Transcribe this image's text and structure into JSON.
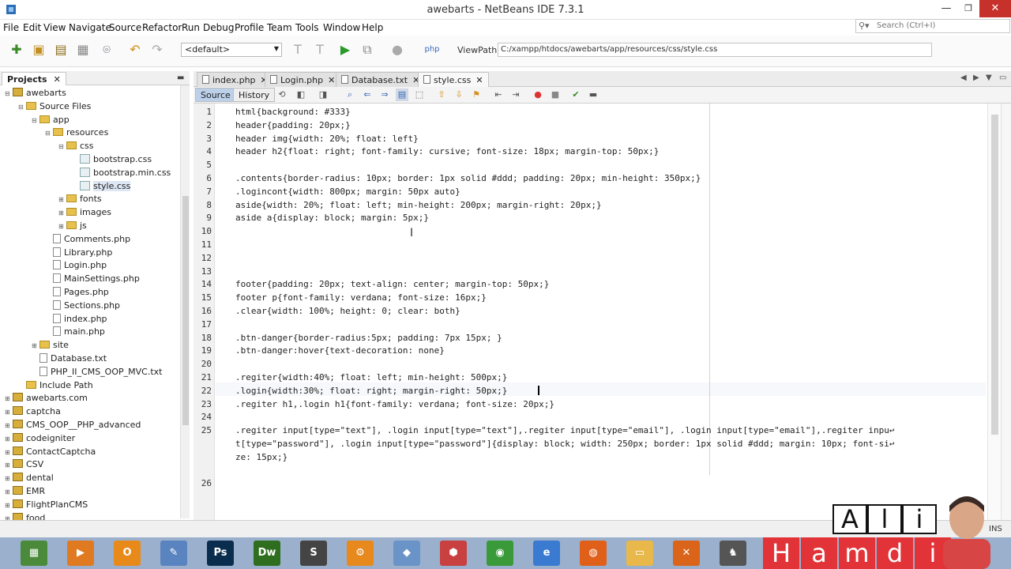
{
  "window": {
    "title": "awebarts - NetBeans IDE 7.3.1",
    "min": "—",
    "max": "❐",
    "close": "✕"
  },
  "menu": [
    "File",
    "Edit",
    "View",
    "Navigate",
    "Source",
    "Refactor",
    "Run",
    "Debug",
    "Profile",
    "Team",
    "Tools",
    "Window",
    "Help"
  ],
  "search": {
    "placeholder": "Search (Ctrl+I)"
  },
  "toolbar": {
    "config": "<default>",
    "viewpath_label": "ViewPath :",
    "viewpath_value": "C:/xampp/htdocs/awebarts/app/resources/css/style.css"
  },
  "projects": {
    "tab": "Projects",
    "tree": [
      {
        "label": "awebarts",
        "kind": "proj",
        "level": 0,
        "exp": "⊟"
      },
      {
        "label": "Source Files",
        "kind": "fold",
        "level": 1,
        "exp": "⊟"
      },
      {
        "label": "app",
        "kind": "fold",
        "level": 2,
        "exp": "⊟"
      },
      {
        "label": "resources",
        "kind": "fold",
        "level": 3,
        "exp": "⊟"
      },
      {
        "label": "css",
        "kind": "fold",
        "level": 4,
        "exp": "⊟"
      },
      {
        "label": "bootstrap.css",
        "kind": "css",
        "level": 5,
        "exp": ""
      },
      {
        "label": "bootstrap.min.css",
        "kind": "css",
        "level": 5,
        "exp": ""
      },
      {
        "label": "style.css",
        "kind": "css",
        "level": 5,
        "exp": "",
        "selected": true
      },
      {
        "label": "fonts",
        "kind": "fold",
        "level": 4,
        "exp": "⊞"
      },
      {
        "label": "images",
        "kind": "fold",
        "level": 4,
        "exp": "⊞"
      },
      {
        "label": "js",
        "kind": "fold",
        "level": 4,
        "exp": "⊞"
      },
      {
        "label": "Comments.php",
        "kind": "file",
        "level": 3,
        "exp": ""
      },
      {
        "label": "Library.php",
        "kind": "file",
        "level": 3,
        "exp": ""
      },
      {
        "label": "Login.php",
        "kind": "file",
        "level": 3,
        "exp": ""
      },
      {
        "label": "MainSettings.php",
        "kind": "file",
        "level": 3,
        "exp": ""
      },
      {
        "label": "Pages.php",
        "kind": "file",
        "level": 3,
        "exp": ""
      },
      {
        "label": "Sections.php",
        "kind": "file",
        "level": 3,
        "exp": ""
      },
      {
        "label": "index.php",
        "kind": "file",
        "level": 3,
        "exp": ""
      },
      {
        "label": "main.php",
        "kind": "file",
        "level": 3,
        "exp": ""
      },
      {
        "label": "site",
        "kind": "fold",
        "level": 2,
        "exp": "⊞"
      },
      {
        "label": "Database.txt",
        "kind": "file",
        "level": 2,
        "exp": ""
      },
      {
        "label": "PHP_II_CMS_OOP_MVC.txt",
        "kind": "file",
        "level": 2,
        "exp": ""
      },
      {
        "label": "Include Path",
        "kind": "fold",
        "level": 1,
        "exp": ""
      },
      {
        "label": "awebarts.com",
        "kind": "proj",
        "level": 0,
        "exp": "⊞"
      },
      {
        "label": "captcha",
        "kind": "proj",
        "level": 0,
        "exp": "⊞"
      },
      {
        "label": "CMS_OOP__PHP_advanced",
        "kind": "proj",
        "level": 0,
        "exp": "⊞"
      },
      {
        "label": "codeigniter",
        "kind": "proj",
        "level": 0,
        "exp": "⊞"
      },
      {
        "label": "ContactCaptcha",
        "kind": "proj",
        "level": 0,
        "exp": "⊞"
      },
      {
        "label": "CSV",
        "kind": "proj",
        "level": 0,
        "exp": "⊞"
      },
      {
        "label": "dental",
        "kind": "proj",
        "level": 0,
        "exp": "⊞"
      },
      {
        "label": "EMR",
        "kind": "proj",
        "level": 0,
        "exp": "⊞"
      },
      {
        "label": "FlightPlanCMS",
        "kind": "proj",
        "level": 0,
        "exp": "⊞"
      },
      {
        "label": "food",
        "kind": "proj",
        "level": 0,
        "exp": "⊞"
      }
    ]
  },
  "editor": {
    "tabs": [
      "index.php",
      "Login.php",
      "Database.txt",
      "style.css"
    ],
    "active_tab": 3,
    "source_label": "Source",
    "history_label": "History",
    "lines": [
      {
        "n": "1",
        "text": "html{background: #333}"
      },
      {
        "n": "2",
        "text": "header{padding: 20px;}"
      },
      {
        "n": "3",
        "text": "header img{width: 20%; float: left}"
      },
      {
        "n": "4",
        "text": "header h2{float: right; font-family: cursive; font-size: 18px; margin-top: 50px;}"
      },
      {
        "n": "5",
        "text": ""
      },
      {
        "n": "6",
        "text": ".contents{border-radius: 10px; border: 1px solid #ddd; padding: 20px; min-height: 350px;}"
      },
      {
        "n": "7",
        "text": ".logincont{width: 800px; margin: 50px auto}"
      },
      {
        "n": "8",
        "text": "aside{width: 20%; float: left; min-height: 200px; margin-right: 20px;}"
      },
      {
        "n": "9",
        "text": "aside a{display: block; margin: 5px;}"
      },
      {
        "n": "10",
        "text": ""
      },
      {
        "n": "11",
        "text": ""
      },
      {
        "n": "12",
        "text": ""
      },
      {
        "n": "13",
        "text": ""
      },
      {
        "n": "14",
        "text": "footer{padding: 20px; text-align: center; margin-top: 50px;}"
      },
      {
        "n": "15",
        "text": "footer p{font-family: verdana; font-size: 16px;}"
      },
      {
        "n": "16",
        "text": ".clear{width: 100%; height: 0; clear: both}"
      },
      {
        "n": "17",
        "text": ""
      },
      {
        "n": "18",
        "text": ".btn-danger{border-radius:5px; padding: 7px 15px; }"
      },
      {
        "n": "19",
        "text": ".btn-danger:hover{text-decoration: none}"
      },
      {
        "n": "20",
        "text": ""
      },
      {
        "n": "21",
        "text": ".regiter{width:40%; float: left; min-height: 500px;}"
      },
      {
        "n": "22",
        "text": ".login{width:30%; float: right; margin-right: 50px;}"
      },
      {
        "n": "23",
        "text": ".regiter h1,.login h1{font-family: verdana; font-size: 20px;}"
      },
      {
        "n": "24",
        "text": ""
      },
      {
        "n": "25",
        "text": ".regiter input[type=\"text\"], .login input[type=\"text\"],.regiter input[type=\"email\"], .login input[type=\"email\"],.regiter inpu↩"
      },
      {
        "n": "",
        "text": "t[type=\"password\"], .login input[type=\"password\"]{display: block; width: 250px; border: 1px solid #ddd; margin: 10px; font-si↩"
      },
      {
        "n": "",
        "text": "ze: 15px;}"
      },
      {
        "n": "",
        "text": ""
      },
      {
        "n": "26",
        "text": ""
      }
    ]
  },
  "status": {
    "mode": "INS"
  },
  "taskbar": [
    {
      "name": "chart-app-icon",
      "glyph": "▦",
      "color": "#4a8a3a"
    },
    {
      "name": "media-player-icon",
      "glyph": "▶",
      "color": "#e07a20"
    },
    {
      "name": "outlook-icon",
      "glyph": "O",
      "color": "#e88a1a"
    },
    {
      "name": "notepad-icon",
      "glyph": "✎",
      "color": "#5a84c0"
    },
    {
      "name": "photoshop-icon",
      "glyph": "Ps",
      "color": "#0b2d4d"
    },
    {
      "name": "dreamweaver-icon",
      "glyph": "Dw",
      "color": "#2e6e1e"
    },
    {
      "name": "sublime-icon",
      "glyph": "S",
      "color": "#444444"
    },
    {
      "name": "settings-icon",
      "glyph": "⚙",
      "color": "#e8891e"
    },
    {
      "name": "netbeans-icon",
      "glyph": "◆",
      "color": "#6a94c8"
    },
    {
      "name": "shield-app-icon",
      "glyph": "⬢",
      "color": "#c84040"
    },
    {
      "name": "chrome-icon",
      "glyph": "◉",
      "color": "#3a9a3a"
    },
    {
      "name": "ie-icon",
      "glyph": "e",
      "color": "#3a7ad0"
    },
    {
      "name": "firefox-icon",
      "glyph": "◍",
      "color": "#e0601a"
    },
    {
      "name": "explorer-icon",
      "glyph": "▭",
      "color": "#e8b84a"
    },
    {
      "name": "xampp-icon",
      "glyph": "✕",
      "color": "#d9641a"
    },
    {
      "name": "game-icon",
      "glyph": "♞",
      "color": "#555555"
    }
  ],
  "watermark": {
    "top": [
      "A",
      "l",
      "i"
    ],
    "bottom": [
      "H",
      "a",
      "m",
      "d",
      "i"
    ]
  }
}
